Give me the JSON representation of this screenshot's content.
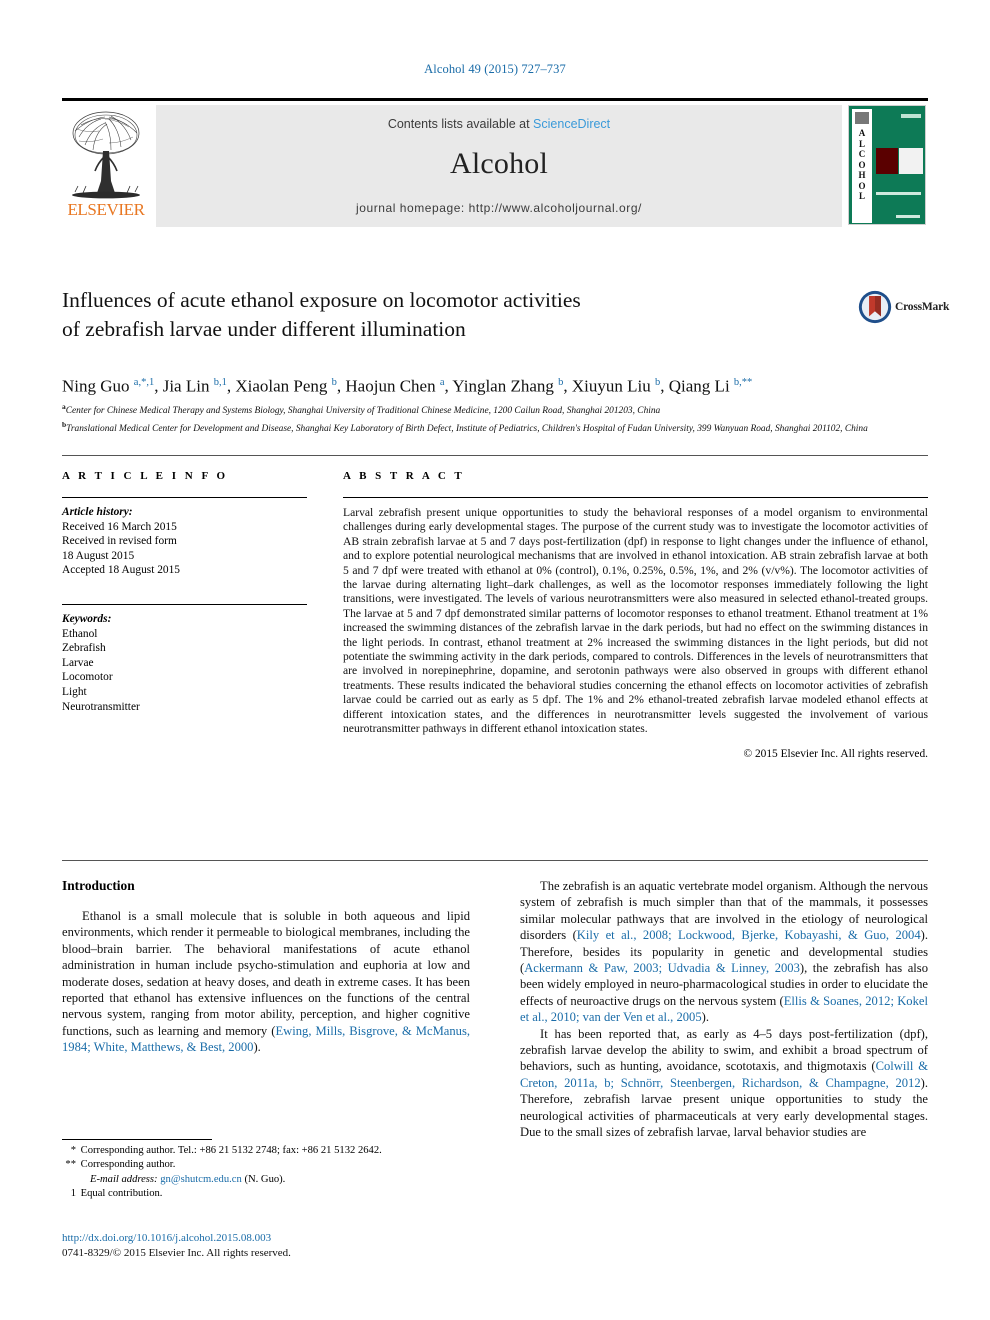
{
  "running_head": "Alcohol 49 (2015) 727–737",
  "masthead": {
    "contents_prefix": "Contents lists available at ",
    "sciencedirect": "ScienceDirect",
    "journal_name": "Alcohol",
    "homepage": "journal homepage: http://www.alcoholjournal.org/",
    "publisher": "ELSEVIER",
    "cover_letters": "ALCOHOL",
    "accent_blue": "#3a9ad9",
    "elsevier_orange": "#E87722",
    "cover_green": "#0d7a56"
  },
  "article": {
    "title_line1": "Influences of acute ethanol exposure on locomotor activities",
    "title_line2": "of zebrafish larvae under different illumination",
    "crossmark_label": "CrossMark",
    "authors_html": "Ning Guo <sup>a,*,1</sup>, Jia Lin <sup>b,1</sup>, Xiaolan Peng <sup>b</sup>, Haojun Chen <sup>a</sup>, Yinglan Zhang <sup>b</sup>, Xiuyun Liu <sup>b</sup>, Qiang Li <sup>b,**</sup>",
    "affiliation_a": "Center for Chinese Medical Therapy and Systems Biology, Shanghai University of Traditional Chinese Medicine, 1200 Cailun Road, Shanghai 201203, China",
    "affiliation_b": "Translational Medical Center for Development and Disease, Shanghai Key Laboratory of Birth Defect, Institute of Pediatrics, Children's Hospital of Fudan University, 399 Wanyuan Road, Shanghai 201102, China"
  },
  "headings": {
    "article_info": "A R T I C L E   I N F O",
    "abstract": "A B S T R A C T",
    "introduction": "Introduction"
  },
  "article_info": {
    "history_label": "Article history:",
    "history": [
      "Received 16 March 2015",
      "Received in revised form",
      "18 August 2015",
      "Accepted 18 August 2015"
    ],
    "keywords_label": "Keywords:",
    "keywords": [
      "Ethanol",
      "Zebrafish",
      "Larvae",
      "Locomotor",
      "Light",
      "Neurotransmitter"
    ]
  },
  "abstract": {
    "text": "Larval zebrafish present unique opportunities to study the behavioral responses of a model organism to environmental challenges during early developmental stages. The purpose of the current study was to investigate the locomotor activities of AB strain zebrafish larvae at 5 and 7 days post-fertilization (dpf) in response to light changes under the influence of ethanol, and to explore potential neurological mechanisms that are involved in ethanol intoxication. AB strain zebrafish larvae at both 5 and 7 dpf were treated with ethanol at 0% (control), 0.1%, 0.25%, 0.5%, 1%, and 2% (v/v%). The locomotor activities of the larvae during alternating light–dark challenges, as well as the locomotor responses immediately following the light transitions, were investigated. The levels of various neurotransmitters were also measured in selected ethanol-treated groups. The larvae at 5 and 7 dpf demonstrated similar patterns of locomotor responses to ethanol treatment. Ethanol treatment at 1% increased the swimming distances of the zebrafish larvae in the dark periods, but had no effect on the swimming distances in the light periods. In contrast, ethanol treatment at 2% increased the swimming distances in the light periods, but did not potentiate the swimming activity in the dark periods, compared to controls. Differences in the levels of neurotransmitters that are involved in norepinephrine, dopamine, and serotonin pathways were also observed in groups with different ethanol treatments. These results indicated the behavioral studies concerning the ethanol effects on locomotor activities of zebrafish larvae could be carried out as early as 5 dpf. The 1% and 2% ethanol-treated zebrafish larvae modeled ethanol effects at different intoxication states, and the differences in neurotransmitter levels suggested the involvement of various neurotransmitter pathways in different ethanol intoxication states.",
    "copyright": "© 2015 Elsevier Inc. All rights reserved."
  },
  "introduction": {
    "left_para_1_html": "Ethanol is a small molecule that is soluble in both aqueous and lipid environments, which render it permeable to biological membranes, including the blood–brain barrier. The behavioral manifestations of acute ethanol administration in human include psycho-stimulation and euphoria at low and moderate doses, sedation at heavy doses, and death in extreme cases. It has been reported that ethanol has extensive influences on the functions of the central nervous system, ranging from motor ability, perception, and higher cognitive functions, such as learning and memory (<span class=\"cite\">Ewing, Mills, Bisgrove, &amp; McManus, 1984; White, Matthews, &amp; Best, 2000</span>).",
    "right_para_1_html": "The zebrafish is an aquatic vertebrate model organism. Although the nervous system of zebrafish is much simpler than that of the mammals, it possesses similar molecular pathways that are involved in the etiology of neurological disorders (<span class=\"cite\">Kily et al., 2008; Lockwood, Bjerke, Kobayashi, &amp; Guo, 2004</span>). Therefore, besides its popularity in genetic and developmental studies (<span class=\"cite\">Ackermann &amp; Paw, 2003; Udvadia &amp; Linney, 2003</span>), the zebrafish has also been widely employed in neuro-pharmacological studies in order to elucidate the effects of neuroactive drugs on the nervous system (<span class=\"cite\">Ellis &amp; Soanes, 2012; Kokel et al., 2010; van der Ven et al., 2005</span>).",
    "right_para_2_html": "It has been reported that, as early as 4–5 days post-fertilization (dpf), zebrafish larvae develop the ability to swim, and exhibit a broad spectrum of behaviors, such as hunting, avoidance, scototaxis, and thigmotaxis (<span class=\"cite\">Colwill &amp; Creton, 2011a, b; Schnörr, Steenbergen, Richardson, &amp; Champagne, 2012</span>). Therefore, zebrafish larvae present unique opportunities to study the neurological activities of pharmaceuticals at very early developmental stages. Due to the small sizes of zebrafish larvae, larval behavior studies are"
  },
  "footnotes": {
    "line1_mark": "*",
    "line1": "Corresponding author. Tel.: +86 21 5132 2748; fax: +86 21 5132 2642.",
    "line2_mark": "**",
    "line2": "Corresponding author.",
    "email_label": "E-mail address:",
    "email": "gn@shutcm.edu.cn",
    "email_suffix": "(N. Guo).",
    "line3_mark": "1",
    "line3": "Equal contribution."
  },
  "footer": {
    "doi": "http://dx.doi.org/10.1016/j.alcohol.2015.08.003",
    "issn_copyright": "0741-8329/© 2015 Elsevier Inc. All rights reserved."
  }
}
